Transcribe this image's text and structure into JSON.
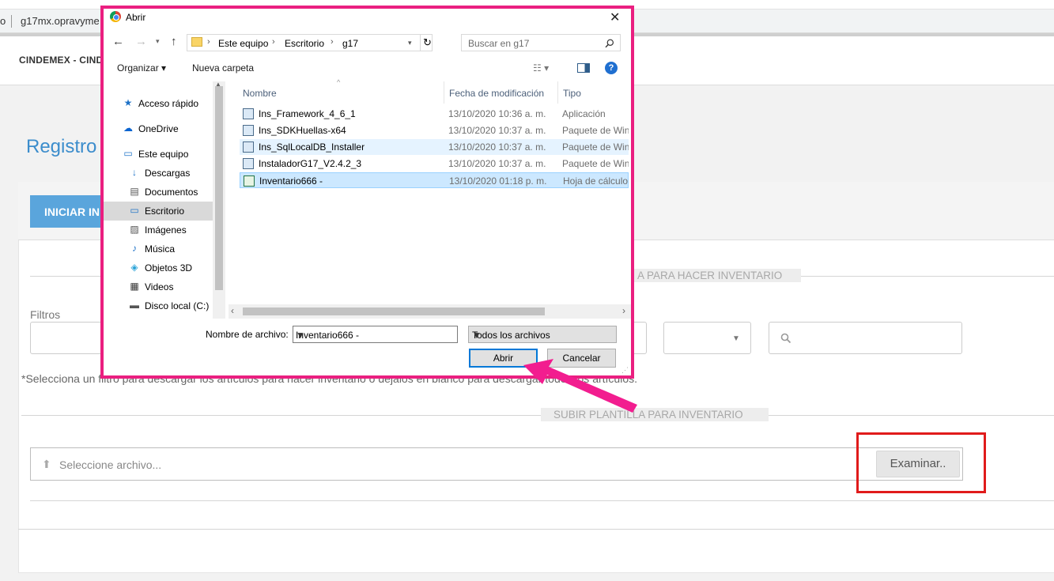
{
  "browser": {
    "o_fragment": "o",
    "url": "g17mx.opravyme"
  },
  "app": {
    "brand": "CINDEMEX - CIND",
    "page_title": "Registro",
    "iniciar_button": "INICIAR IN",
    "legend_download": "A PARA HACER INVENTARIO",
    "filters_label": "Filtros",
    "hint": "*Selecciona un filtro para descargar los artículos para hacer inventario o déjalos en blanco para descargar todos los artículos.",
    "legend_upload": "SUBIR PLANTILLA PARA INVENTARIO",
    "upload_placeholder": "Seleccione archivo...",
    "examinar_button": "Examinar.."
  },
  "dialog": {
    "title": "Abrir",
    "breadcrumb": [
      "Este equipo",
      "Escritorio",
      "g17"
    ],
    "search_placeholder": "Buscar en g17",
    "toolbar": {
      "organize": "Organizar ▾",
      "new_folder": "Nueva carpeta"
    },
    "nav_items": [
      {
        "label": "Acceso rápido",
        "icon": "★"
      },
      {
        "label": "OneDrive",
        "icon": "☁"
      },
      {
        "label": "Este equipo",
        "icon": "▭"
      },
      {
        "label": "Descargas",
        "icon": "↓"
      },
      {
        "label": "Documentos",
        "icon": "▤"
      },
      {
        "label": "Escritorio",
        "icon": "▭"
      },
      {
        "label": "Imágenes",
        "icon": "▨"
      },
      {
        "label": "Música",
        "icon": "♪"
      },
      {
        "label": "Objetos 3D",
        "icon": "◈"
      },
      {
        "label": "Videos",
        "icon": "▦"
      },
      {
        "label": "Disco local (C:)",
        "icon": "▬"
      }
    ],
    "columns": {
      "name": "Nombre",
      "modified": "Fecha de modificación",
      "type": "Tipo"
    },
    "files": [
      {
        "name": "Ins_Framework_4_6_1",
        "date": "13/10/2020 10:36 a. m.",
        "type": "Aplicación"
      },
      {
        "name": "Ins_SDKHuellas-x64",
        "date": "13/10/2020 10:37 a. m.",
        "type": "Paquete de Windows"
      },
      {
        "name": "Ins_SqlLocalDB_Installer",
        "date": "13/10/2020 10:37 a. m.",
        "type": "Paquete de Windows"
      },
      {
        "name": "InstaladorG17_V2.4.2_3",
        "date": "13/10/2020 10:37 a. m.",
        "type": "Paquete de Windows"
      },
      {
        "name": "Inventario666 -",
        "date": "13/10/2020 01:18 p. m.",
        "type": "Hoja de cálculo"
      }
    ],
    "filename_label": "Nombre de archivo:",
    "filename_value": "Inventario666 -",
    "filetype_value": "Todos los archivos",
    "open_button": "Abrir",
    "cancel_button": "Cancelar"
  },
  "colors": {
    "highlight_outline": "#ea1f80",
    "annotation_box": "#e01b1b",
    "accent_blue": "#3c8dcc"
  }
}
